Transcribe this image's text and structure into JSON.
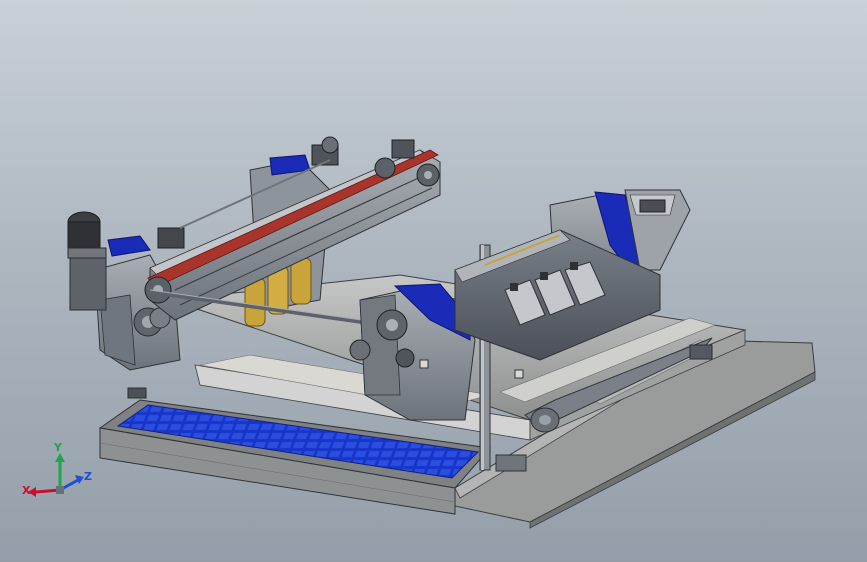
{
  "triad": {
    "x_label": "X",
    "y_label": "Y",
    "z_label": "Z",
    "x_color": "#c8102e",
    "y_color": "#1fa64a",
    "z_color": "#1f4fd1"
  },
  "colors": {
    "frame_gray": "#8c9299",
    "frame_dark": "#5a6068",
    "frame_light": "#b9bec4",
    "accent_blue": "#1a2bb8",
    "belt_red": "#a8342b",
    "roller_yellow": "#c9a43a",
    "mesh_blue": "#1736c9"
  }
}
